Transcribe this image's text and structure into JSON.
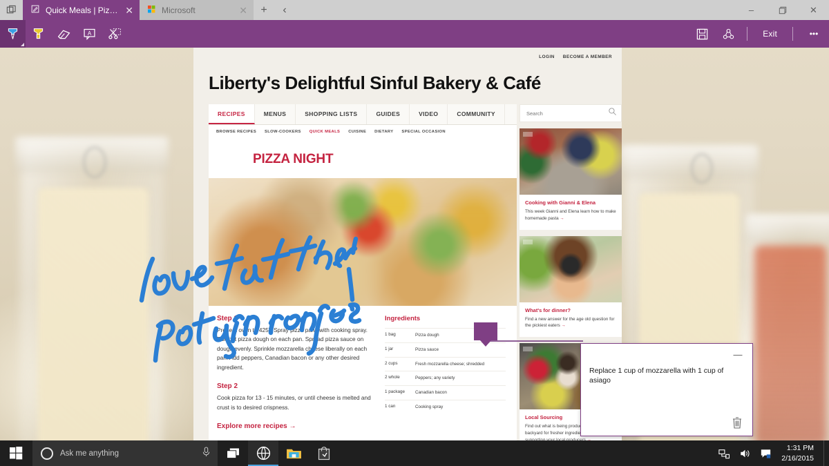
{
  "browser": {
    "tabs": [
      {
        "title": "Quick Meals | Pizza Night",
        "active": true,
        "icon": "note-edit-icon",
        "close": "✕"
      },
      {
        "title": "Microsoft",
        "active": false,
        "icon": "microsoft-logo-icon",
        "close": "✕"
      }
    ],
    "new_tab_label": "+",
    "back_label": "‹",
    "tabs_preview_label": "❐",
    "window_controls": {
      "minimize": "–",
      "maximize": "❐",
      "close": "✕"
    }
  },
  "ink_toolbar": {
    "tools": [
      {
        "name": "pen-tool",
        "label": "Pen",
        "selected": true,
        "color": "#2b8fd8"
      },
      {
        "name": "highlighter-tool",
        "label": "Highlighter",
        "selected": false,
        "color": "#e8c72e"
      },
      {
        "name": "eraser-tool",
        "label": "Eraser",
        "selected": false
      },
      {
        "name": "note-tool",
        "label": "Add a typed note",
        "selected": false
      },
      {
        "name": "clip-tool",
        "label": "Clip",
        "selected": false
      }
    ],
    "save_label": "Save",
    "share_label": "Share",
    "exit_label": "Exit",
    "more_label": "•••",
    "accent_color": "#7f3f84"
  },
  "site": {
    "account_links": [
      "LOGIN",
      "BECOME A MEMBER"
    ],
    "title": "Liberty's Delightful Sinful Bakery & Café",
    "nav": [
      {
        "label": "RECIPES",
        "active": true
      },
      {
        "label": "MENUS",
        "active": false
      },
      {
        "label": "SHOPPING LISTS",
        "active": false
      },
      {
        "label": "GUIDES",
        "active": false
      },
      {
        "label": "VIDEO",
        "active": false
      },
      {
        "label": "COMMUNITY",
        "active": false
      }
    ],
    "subnav": [
      {
        "label": "BROWSE RECIPES",
        "active": false
      },
      {
        "label": "SLOW-COOKERS",
        "active": false
      },
      {
        "label": "QUICK MEALS",
        "active": true
      },
      {
        "label": "CUISINE",
        "active": false
      },
      {
        "label": "DIETARY",
        "active": false
      },
      {
        "label": "SPECIAL OCCASION",
        "active": false
      }
    ],
    "recipe_title": "PIZZA NIGHT",
    "hero_alt": "close-up of pizza with peppers and cheese",
    "steps": [
      {
        "heading": "Step 1",
        "text": "Preheat oven to 425˚. Spray pizza pans with cooking spray. Roll out pizza dough on each pan. Spread pizza sauce on dough evenly. Sprinkle mozzarella cheese liberally on each pan. Add peppers, Canadian bacon or any other desired ingredient."
      },
      {
        "heading": "Step 2",
        "text": "Cook pizza for 13 - 15 minutes, or until cheese is melted and  crust is to desired crispness."
      }
    ],
    "explore_link": "Explore more recipes →",
    "ingredients_heading": "Ingredients",
    "ingredients": [
      {
        "qty": "1 bag",
        "item": "Pizza dough"
      },
      {
        "qty": "1 jar",
        "item": "Pizza sauce"
      },
      {
        "qty": "2 cups",
        "item": "Fresh mozzarella cheese; shredded"
      },
      {
        "qty": "2 whole",
        "item": "Peppers; any variety"
      },
      {
        "qty": "1 package",
        "item": "Canadian bacon"
      },
      {
        "qty": "1 can",
        "item": "Cooking spray"
      }
    ],
    "search": {
      "placeholder": "Search",
      "value": "",
      "icon": "search-icon"
    },
    "cards": [
      {
        "title": "Cooking with Gianni & Elena",
        "text": "This week Gianni and Elena learn how to make homemade pasta",
        "arrow": "→",
        "image_alt": "couple cooking pasta in kitchen"
      },
      {
        "title": "What's for dinner?",
        "text": "Find a new answer for the age old question for the pickiest eaters",
        "arrow": "→",
        "image_alt": "child wearing glasses eating"
      },
      {
        "title": "Local Sourcing",
        "text": "Find out what is being produced in your own backyard for fresher ingredients while supporting your local producers",
        "arrow": "→",
        "image_alt": "grocer with crate of vegetables"
      }
    ],
    "accent_red": "#c42340"
  },
  "annotations": {
    "ink_text": "love that they're posting recipes!",
    "ink_color": "#2b7fd4",
    "note": {
      "text": "Replace 1 cup of mozzarella with 1 cup of asiago",
      "minimize_label": "—",
      "delete_icon": "trash-icon",
      "border_color": "#7f3f84"
    },
    "marker_color": "#7f3f84"
  },
  "taskbar": {
    "start_label": "Start",
    "search_placeholder": "Ask me anything",
    "mic_icon": "microphone-icon",
    "cortana_icon": "cortana-circle-icon",
    "taskview_icon": "task-view-icon",
    "apps": [
      {
        "name": "edge-browser",
        "label": "Microsoft Edge",
        "running": true
      },
      {
        "name": "file-explorer",
        "label": "File Explorer",
        "running": false
      },
      {
        "name": "store",
        "label": "Store",
        "running": false
      }
    ],
    "tray": [
      {
        "name": "network-icon",
        "label": "Network"
      },
      {
        "name": "volume-icon",
        "label": "Volume"
      },
      {
        "name": "action-center-icon",
        "label": "Action Center"
      }
    ],
    "time": "1:31 PM",
    "date": "2/16/2015"
  }
}
